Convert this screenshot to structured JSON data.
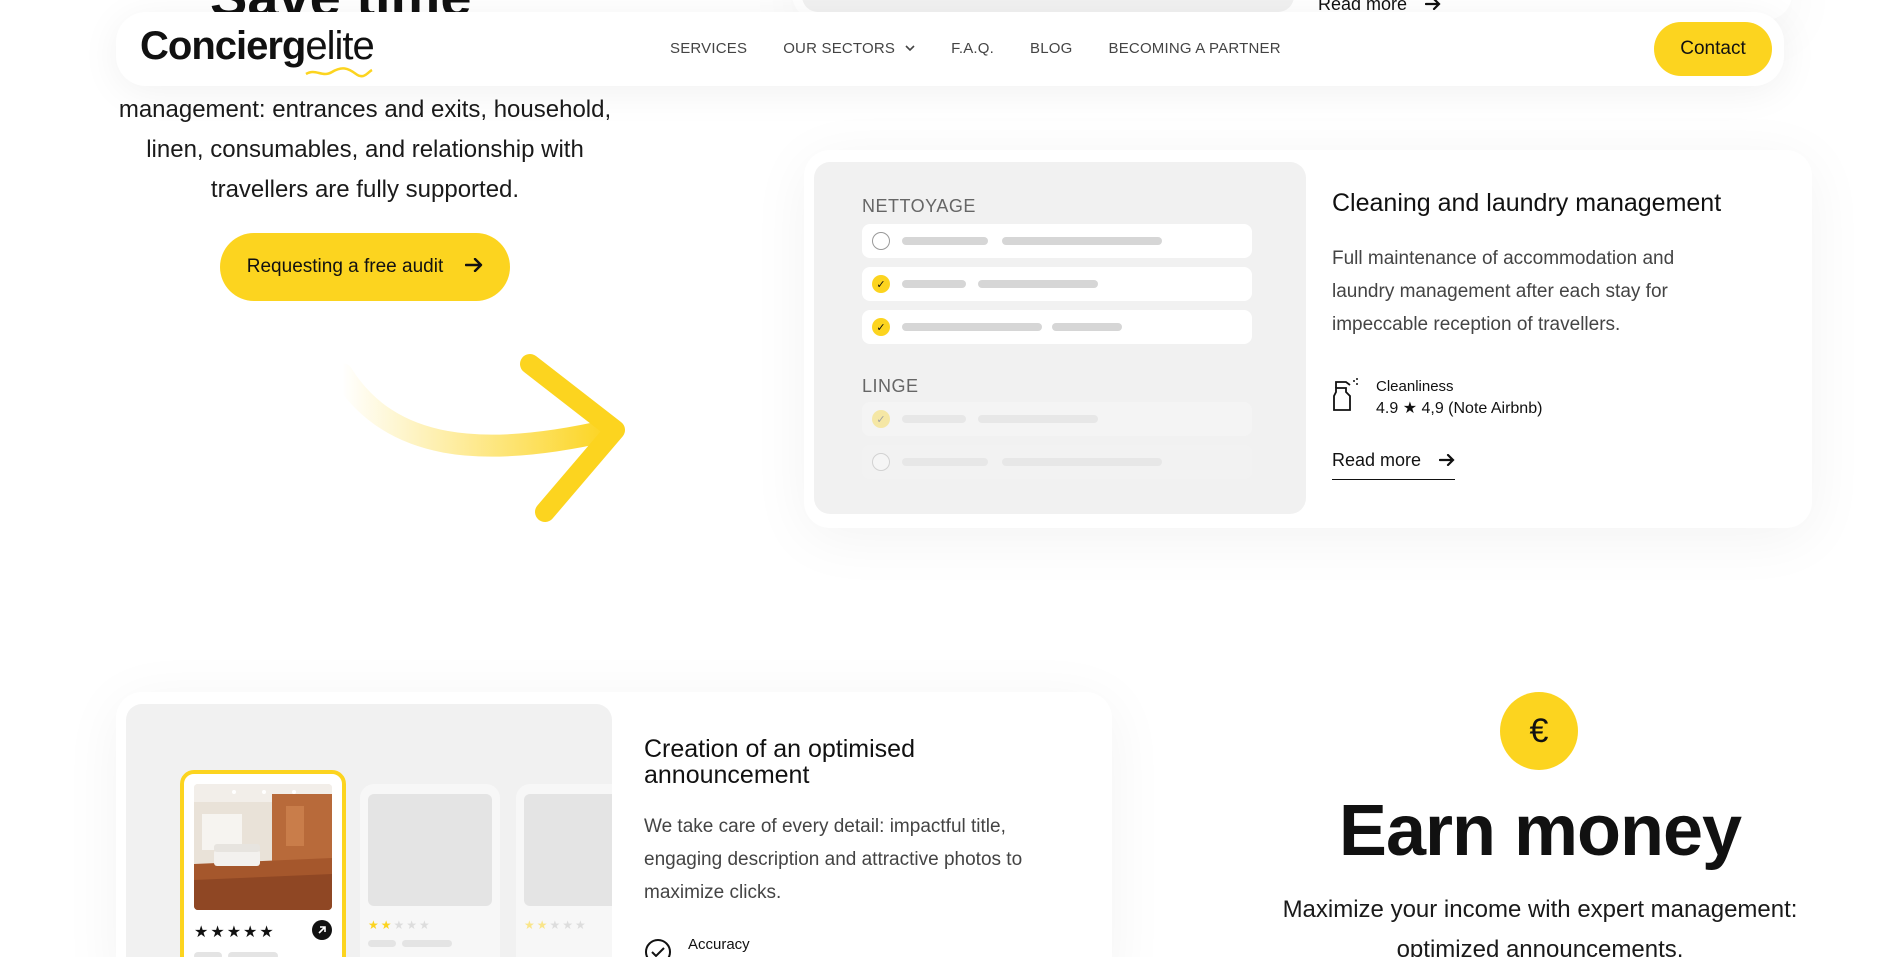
{
  "header": {
    "logo_bold": "Concierg",
    "logo_light": "elite",
    "nav": [
      "SERVICES",
      "OUR SECTORS",
      "F.A.Q.",
      "BLOG",
      "BECOMING A PARTNER"
    ],
    "contact_label": "Contact"
  },
  "hero": {
    "title_partial": "Save time",
    "text": "management: entrances and exits, household, linen, consumables, and relationship with travellers are fully supported.",
    "audit_button": "Requesting a free audit"
  },
  "top_card": {
    "read_more": "Read more"
  },
  "cleaning_card": {
    "mock_section1": "NETTOYAGE",
    "mock_section2": "LINGE",
    "title": "Cleaning and laundry management",
    "description": "Full maintenance of accommodation and laundry management after each stay for impeccable reception of travellers.",
    "rating_label": "Cleanliness",
    "rating_value": "4.9 ★ 4,9 (Note Airbnb)",
    "read_more": "Read more"
  },
  "announcement_card": {
    "title": "Creation of an optimised announcement",
    "description": "We take care of every detail: impactful title, engaging description and attractive photos to maximize clicks.",
    "rating_label": "Accuracy",
    "stars_selected": 5,
    "stars_other_1": 2,
    "stars_other_2": 2
  },
  "earn": {
    "icon": "€",
    "title": "Earn money",
    "description": "Maximize your income with expert management: optimized announcements,"
  },
  "colors": {
    "accent": "#fcd41f",
    "text": "#111111",
    "muted": "#444444",
    "panel": "#f1f1f1"
  }
}
